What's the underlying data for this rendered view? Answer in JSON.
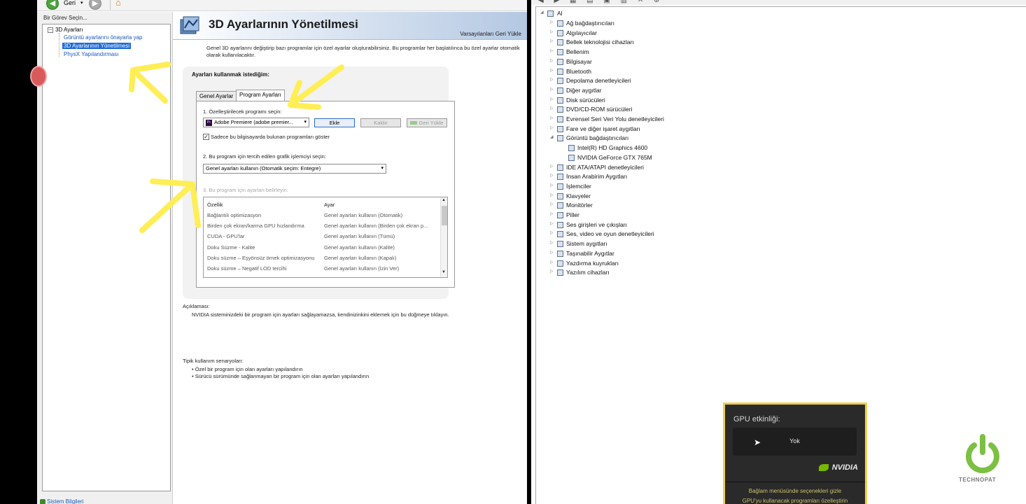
{
  "toolbar": {
    "back_label": "Geri",
    "back_dropdown": "▾"
  },
  "task_panel": {
    "title": "Bir Görev Seçin...",
    "tree_root": "3D Ayarları",
    "tree_expander": "−",
    "items": [
      "Görüntü ayarlarını önayarla yap",
      "3D Ayarlarının Yönetilmesi",
      "PhysX Yapılandırması"
    ],
    "system_info": "Sistem Bilgileri"
  },
  "main": {
    "title": "3D Ayarlarının Yönetilmesi",
    "restore_defaults": "Varsayılanları Geri Yükle",
    "intro": "Genel 3D ayarlarını değiştirip bazı programlar için özel ayarlar oluşturabilirsiniz. Bu programlar her başlatılınca bu özel ayarlar otomatik olarak kullanılacaktır.",
    "settings_heading": "Ayarları kullanmak istediğim:",
    "tabs": [
      "Genel Ayarlar",
      "Program Ayarları"
    ],
    "step1": "1. Özelleştirilecek programı seçin:",
    "program_selected": "Adobe Premiere (adobe premier...",
    "premiere_badge": "Pr",
    "add_button": "Ekle",
    "remove_button": "Kaldır",
    "restore_button": "Geri Yükle",
    "checkbox_mark": "✓",
    "show_only_label": "Sadece bu bilgisayarda bulunan programları göster",
    "step2": "2. Bu program için tercih edilen grafik işlemciyi seçin:",
    "graphics_selected": "Genel ayarları kullanın (Otomatik seçim: Entegre)",
    "step3": "3. Bu program için ayarları belirleyin:",
    "table_headers": [
      "Özellik",
      "Ayar"
    ],
    "table_rows": [
      [
        "Bağlantılı optimizasyon",
        "Genel ayarları kullanın (Otomatik)"
      ],
      [
        "Birden çok ekran/karma GPU hızlandırma",
        "Genel ayarları kullanın (Birden çok ekran p..."
      ],
      [
        "CUDA - GPU'lar",
        "Genel ayarları kullanın (Tümü)"
      ],
      [
        "Doku Süzme - Kalite",
        "Genel ayarları kullanın (Kalite)"
      ],
      [
        "Doku süzme – Eşyönsüz örnek optimizasyonu",
        "Genel ayarları kullanın (Kapalı)"
      ],
      [
        "Doku süzme – Negatif LOD tercihi",
        "Genel ayarları kullanın (İzin Ver)"
      ]
    ],
    "description_title": "Açıklaması:",
    "description": "NVIDIA sisteminizdeki bir program için ayarları sağlayamazsa, kendinizinkini eklemek için bu düğmeye tıklayın.",
    "scenarios_title": "Tipik kullanım senaryoları:",
    "scenarios": [
      "• Özel bir program için olan ayarları yapılandırın",
      "• Sürücü sürümünde sağlanmayan bir program için olan ayarları yapılandırın"
    ]
  },
  "device_manager": {
    "toolbar_icons": "◀ ▶ ▦ ▤ ▣ ▥ ✕ ⊕",
    "root": "Al",
    "categories": [
      {
        "label": "Ağ bağdaştırıcıları",
        "icon": "network-icon",
        "expanded": false,
        "level": 1
      },
      {
        "label": "Algılayıcılar",
        "icon": "sensor-icon",
        "expanded": false,
        "level": 1
      },
      {
        "label": "Bellek teknolojisi cihazları",
        "icon": "memory-icon",
        "expanded": false,
        "level": 1
      },
      {
        "label": "Bellenim",
        "icon": "firmware-icon",
        "expanded": false,
        "level": 1
      },
      {
        "label": "Bilgisayar",
        "icon": "computer-icon",
        "expanded": false,
        "level": 1
      },
      {
        "label": "Bluetooth",
        "icon": "bluetooth-icon",
        "expanded": false,
        "level": 1
      },
      {
        "label": "Depolama denetleyicileri",
        "icon": "storage-icon",
        "expanded": false,
        "level": 1
      },
      {
        "label": "Diğer aygıtlar",
        "icon": "other-device-icon",
        "expanded": false,
        "level": 1
      },
      {
        "label": "Disk sürücüleri",
        "icon": "disk-icon",
        "expanded": false,
        "level": 1
      },
      {
        "label": "DVD/CD-ROM sürücüleri",
        "icon": "dvd-icon",
        "expanded": false,
        "level": 1
      },
      {
        "label": "Evrensel Seri Veri Yolu denetleyicileri",
        "icon": "usb-icon",
        "expanded": false,
        "level": 1
      },
      {
        "label": "Fare ve diğer işaret aygıtları",
        "icon": "mouse-icon",
        "expanded": false,
        "level": 1
      },
      {
        "label": "Görüntü bağdaştırıcıları",
        "icon": "display-adapter-icon",
        "expanded": true,
        "level": 1
      },
      {
        "label": "Intel(R) HD Graphics 4600",
        "icon": "display-adapter-icon",
        "expanded": false,
        "level": 2
      },
      {
        "label": "NVIDIA GeForce GTX 765M",
        "icon": "display-adapter-icon",
        "expanded": false,
        "level": 2
      },
      {
        "label": "IDE ATA/ATAPI denetleyicileri",
        "icon": "ide-icon",
        "expanded": false,
        "level": 1
      },
      {
        "label": "İnsan Arabirim Aygıtları",
        "icon": "hid-icon",
        "expanded": false,
        "level": 1
      },
      {
        "label": "İşlemciler",
        "icon": "processor-icon",
        "expanded": false,
        "level": 1
      },
      {
        "label": "Klavyeler",
        "icon": "keyboard-icon",
        "expanded": false,
        "level": 1
      },
      {
        "label": "Monitörler",
        "icon": "monitor-icon",
        "expanded": false,
        "level": 1
      },
      {
        "label": "Piller",
        "icon": "battery-icon",
        "expanded": false,
        "level": 1
      },
      {
        "label": "Ses girişleri ve çıkışları",
        "icon": "audio-icon",
        "expanded": false,
        "level": 1
      },
      {
        "label": "Ses, video ve oyun denetleyicileri",
        "icon": "sound-icon",
        "expanded": false,
        "level": 1
      },
      {
        "label": "Sistem aygıtları",
        "icon": "system-icon",
        "expanded": false,
        "level": 1
      },
      {
        "label": "Taşınabilir Aygıtlar",
        "icon": "portable-icon",
        "expanded": false,
        "level": 1
      },
      {
        "label": "Yazdırma kuyrukları",
        "icon": "printer-icon",
        "expanded": false,
        "level": 1
      },
      {
        "label": "Yazılım cihazları",
        "icon": "software-icon",
        "expanded": false,
        "level": 1
      }
    ]
  },
  "gpu_popup": {
    "title": "GPU etkinliği:",
    "value": "Yok",
    "brand": "NVIDIA",
    "hint_line1": "Bağlam menüsünde seçenekleri gizle",
    "hint_line2": "GPU'yu kullanacak programları özelleştirin"
  },
  "watermark": {
    "text": "TECHNOPAT"
  },
  "colors": {
    "annotation_yellow": "#ffee55",
    "nvidia_green": "#76b900",
    "selection_blue": "#1e6bd6",
    "popup_border": "#f0cf4a"
  }
}
